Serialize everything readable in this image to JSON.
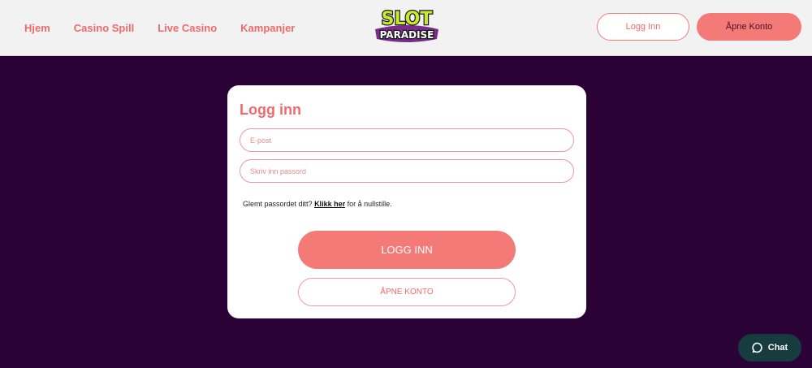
{
  "nav": {
    "items": [
      {
        "label": "Hjem"
      },
      {
        "label": "Casino Spill"
      },
      {
        "label": "Live Casino"
      },
      {
        "label": "Kampanjer"
      }
    ]
  },
  "logo": {
    "line1": "SLOT",
    "line2": "PARADISE"
  },
  "header": {
    "login_label": "Logg Inn",
    "register_label": "Åpne Konto"
  },
  "login_form": {
    "title": "Logg inn",
    "email_placeholder": "E-post",
    "password_placeholder": "Skriv inn passord",
    "forgot_prefix": "Glemt passordet ditt?",
    "forgot_link": "Klikk her",
    "forgot_suffix": "for å nullstille.",
    "submit_label": "LOGG INN",
    "register_label": "ÅPNE KONTO"
  },
  "chat": {
    "label": "Chat"
  },
  "colors": {
    "accent": "#f47a78",
    "background": "#2a0236",
    "chat": "#173c3f"
  }
}
